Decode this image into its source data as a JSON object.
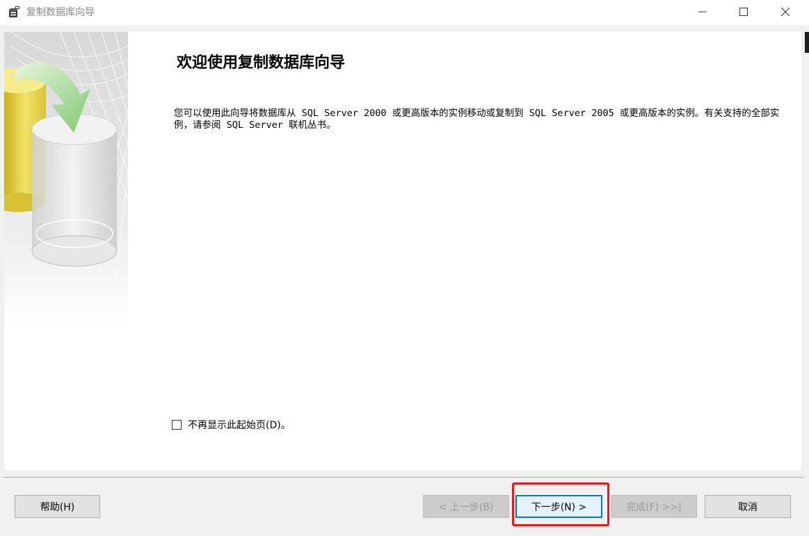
{
  "window": {
    "title": "复制数据库向导",
    "controls": {
      "minimize_icon": "minimize-icon",
      "maximize_icon": "maximize-icon",
      "close_icon": "close-icon"
    }
  },
  "page": {
    "title": "欢迎使用复制数据库向导",
    "description": "您可以使用此向导将数据库从 SQL Server 2000 或更高版本的实例移动或复制到 SQL Server 2005 或更高版本的实例。有关支持的全部实例，请参阅 SQL Server 联机丛书。",
    "dont_show_checkbox": {
      "label": "不再显示此起始页(D)。",
      "checked": false
    }
  },
  "buttons": {
    "help": "帮助(H)",
    "back": "< 上一步(B)",
    "next": "下一步(N) >",
    "finish": "完成(F) >>|",
    "cancel": "取消"
  },
  "colors": {
    "accent": "#0078d7",
    "highlight": "#e8191c",
    "title_text": "#8a8a8a"
  }
}
